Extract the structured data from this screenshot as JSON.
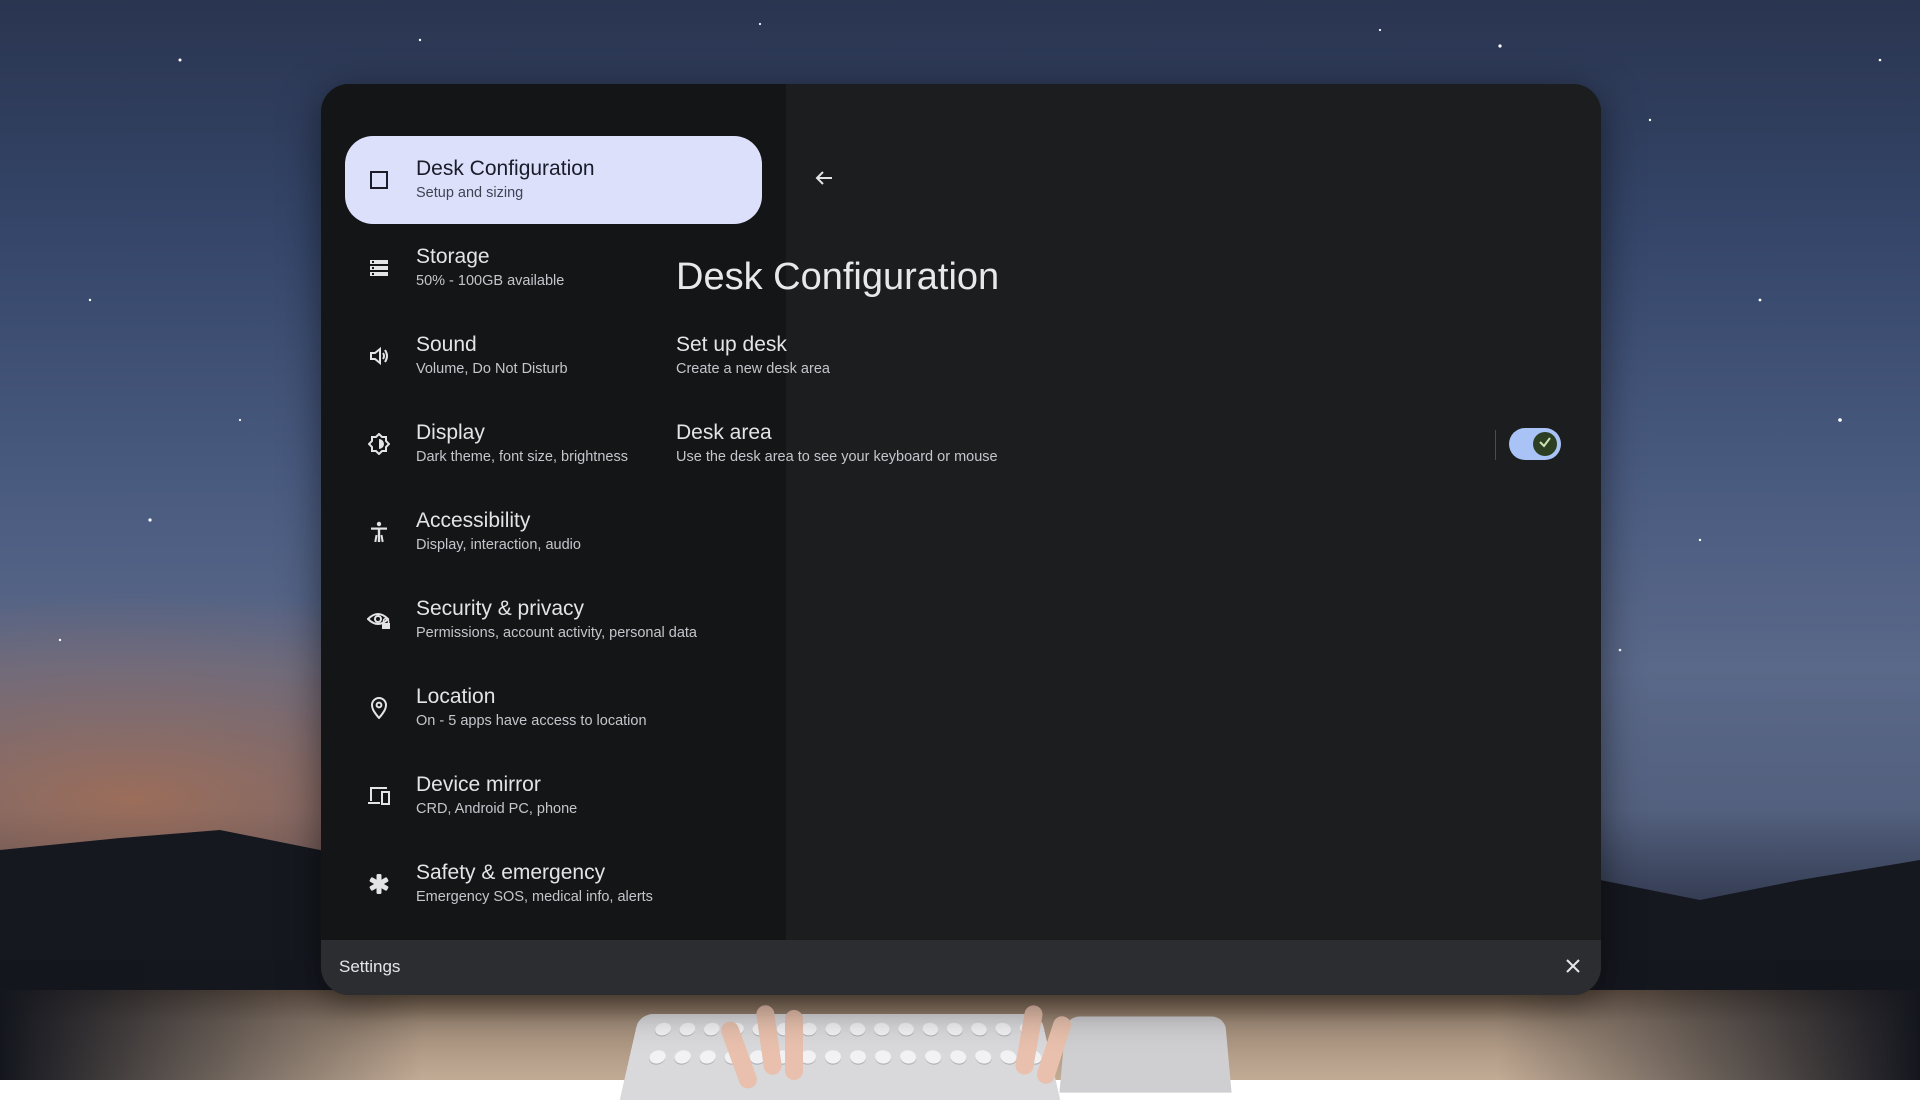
{
  "window": {
    "title": "Settings"
  },
  "nav": {
    "items": [
      {
        "title": "Desk Configuration",
        "subtitle": "Setup and sizing",
        "icon": "square-outline-icon",
        "selected": true
      },
      {
        "title": "Storage",
        "subtitle": "50% - 100GB available",
        "icon": "storage-icon"
      },
      {
        "title": "Sound",
        "subtitle": "Volume, Do Not Disturb",
        "icon": "speaker-icon"
      },
      {
        "title": "Display",
        "subtitle": "Dark theme, font size, brightness",
        "icon": "brightness-icon"
      },
      {
        "title": "Accessibility",
        "subtitle": "Display, interaction, audio",
        "icon": "accessibility-icon"
      },
      {
        "title": "Security & privacy",
        "subtitle": "Permissions, account activity, personal data",
        "icon": "eye-lock-icon"
      },
      {
        "title": "Location",
        "subtitle": "On - 5 apps have access to location",
        "icon": "location-pin-icon"
      },
      {
        "title": "Device mirror",
        "subtitle": "CRD, Android PC, phone",
        "icon": "devices-icon"
      },
      {
        "title": "Safety & emergency",
        "subtitle": "Emergency SOS, medical info, alerts",
        "icon": "asterisk-icon"
      }
    ]
  },
  "detail": {
    "title": "Desk Configuration",
    "rows": [
      {
        "title": "Set up desk",
        "subtitle": "Create a new desk area"
      },
      {
        "title": "Desk area",
        "subtitle": "Use the desk area to see your keyboard or mouse",
        "toggle_on": true
      }
    ]
  },
  "colors": {
    "selected_nav_bg": "#dde0fb",
    "toggle_track": "#a9c3f7",
    "toggle_knob": "#2d3f23"
  }
}
